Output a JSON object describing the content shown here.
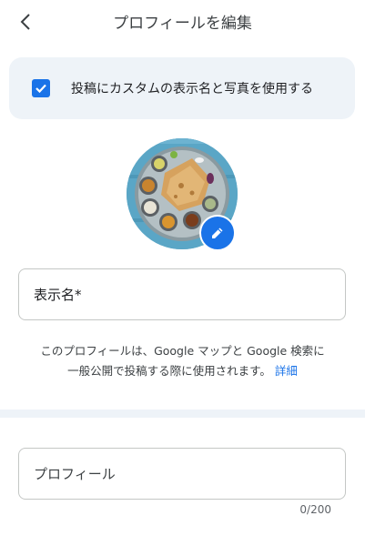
{
  "header": {
    "title": "プロフィールを編集"
  },
  "custom_name_option": {
    "checked": true,
    "label": "投稿にカスタムの表示名と写真を使用する"
  },
  "display_name_field": {
    "label": "表示名*"
  },
  "helper": {
    "line1": "このプロフィールは、Google マップと Google 検索に",
    "line2": "一般公開で投稿する際に使用されます。",
    "link": "詳細"
  },
  "profile_field": {
    "label": "プロフィール",
    "counter": "0/200"
  },
  "colors": {
    "accent": "#1a73e8",
    "card_bg": "#eef3f8",
    "avatar_bg": "#5aa6c6"
  },
  "icons": {
    "back": "arrow-back-icon",
    "check": "check-icon",
    "edit": "pencil-icon"
  }
}
